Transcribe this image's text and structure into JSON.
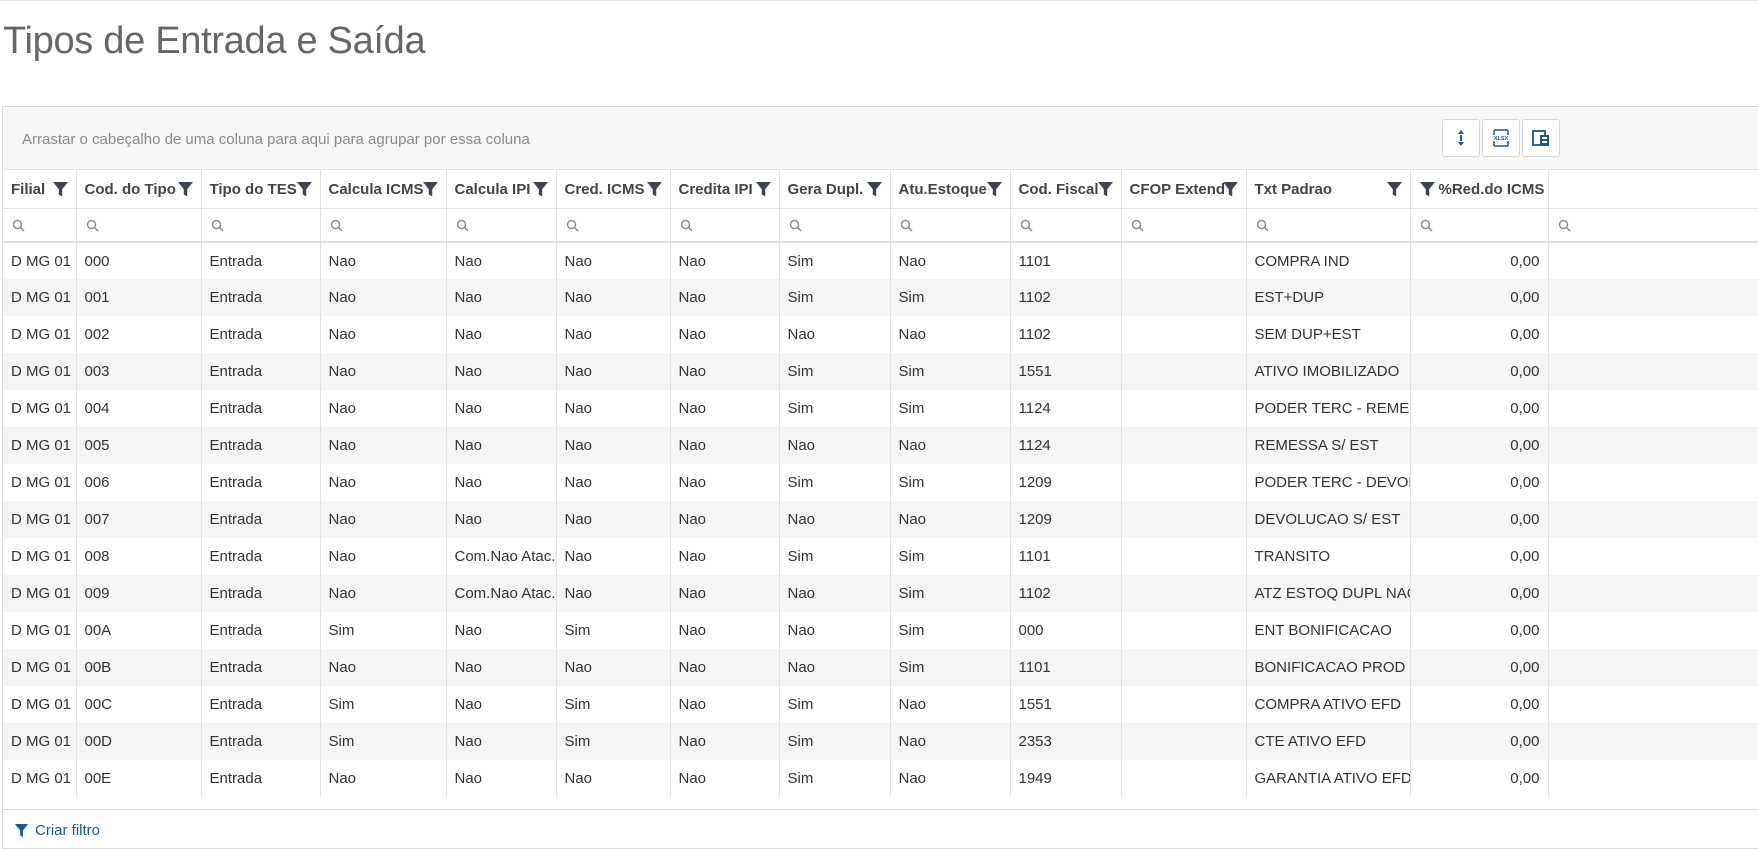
{
  "page": {
    "title": "Tipos de Entrada e Saída"
  },
  "grid": {
    "group_panel_text": "Arrastar o cabeçalho de uma coluna para aqui para agrupar por essa coluna",
    "columns": [
      {
        "label": "Filial"
      },
      {
        "label": "Cod. do Tipo"
      },
      {
        "label": "Tipo do TES"
      },
      {
        "label": "Calcula ICMS"
      },
      {
        "label": "Calcula IPI"
      },
      {
        "label": "Cred. ICMS"
      },
      {
        "label": "Credita IPI"
      },
      {
        "label": "Gera Dupl."
      },
      {
        "label": "Atu.Estoque"
      },
      {
        "label": "Cod. Fiscal"
      },
      {
        "label": "CFOP Extend"
      },
      {
        "label": "Txt Padrao"
      },
      {
        "label": "%Red.do ICMS"
      },
      {
        "label": ""
      }
    ],
    "rows": [
      [
        "D MG 01",
        "000",
        "Entrada",
        "Nao",
        "Nao",
        "Nao",
        "Nao",
        "Sim",
        "Nao",
        "1101",
        "",
        "COMPRA IND",
        "0,00"
      ],
      [
        "D MG 01",
        "001",
        "Entrada",
        "Nao",
        "Nao",
        "Nao",
        "Nao",
        "Sim",
        "Sim",
        "1102",
        "",
        "EST+DUP",
        "0,00"
      ],
      [
        "D MG 01",
        "002",
        "Entrada",
        "Nao",
        "Nao",
        "Nao",
        "Nao",
        "Nao",
        "Nao",
        "1102",
        "",
        "SEM DUP+EST",
        "0,00"
      ],
      [
        "D MG 01",
        "003",
        "Entrada",
        "Nao",
        "Nao",
        "Nao",
        "Nao",
        "Sim",
        "Sim",
        "1551",
        "",
        "ATIVO IMOBILIZADO",
        "0,00"
      ],
      [
        "D MG 01",
        "004",
        "Entrada",
        "Nao",
        "Nao",
        "Nao",
        "Nao",
        "Sim",
        "Sim",
        "1124",
        "",
        "PODER TERC - REMESSA",
        "0,00"
      ],
      [
        "D MG 01",
        "005",
        "Entrada",
        "Nao",
        "Nao",
        "Nao",
        "Nao",
        "Nao",
        "Nao",
        "1124",
        "",
        "REMESSA S/ EST",
        "0,00"
      ],
      [
        "D MG 01",
        "006",
        "Entrada",
        "Nao",
        "Nao",
        "Nao",
        "Nao",
        "Sim",
        "Sim",
        "1209",
        "",
        "PODER TERC - DEVOLUC",
        "0,00"
      ],
      [
        "D MG 01",
        "007",
        "Entrada",
        "Nao",
        "Nao",
        "Nao",
        "Nao",
        "Nao",
        "Nao",
        "1209",
        "",
        "DEVOLUCAO S/ EST",
        "0,00"
      ],
      [
        "D MG 01",
        "008",
        "Entrada",
        "Nao",
        "Com.Nao Atac.",
        "Nao",
        "Nao",
        "Sim",
        "Sim",
        "1101",
        "",
        "TRANSITO",
        "0,00"
      ],
      [
        "D MG 01",
        "009",
        "Entrada",
        "Nao",
        "Com.Nao Atac.",
        "Nao",
        "Nao",
        "Nao",
        "Sim",
        "1102",
        "",
        "ATZ ESTOQ DUPL NAO",
        "0,00"
      ],
      [
        "D MG 01",
        "00A",
        "Entrada",
        "Sim",
        "Nao",
        "Sim",
        "Nao",
        "Nao",
        "Sim",
        "000",
        "",
        "ENT BONIFICACAO",
        "0,00"
      ],
      [
        "D MG 01",
        "00B",
        "Entrada",
        "Nao",
        "Nao",
        "Nao",
        "Nao",
        "Nao",
        "Sim",
        "1101",
        "",
        "BONIFICACAO PROD",
        "0,00"
      ],
      [
        "D MG 01",
        "00C",
        "Entrada",
        "Sim",
        "Nao",
        "Sim",
        "Nao",
        "Sim",
        "Nao",
        "1551",
        "",
        "COMPRA ATIVO EFD",
        "0,00"
      ],
      [
        "D MG 01",
        "00D",
        "Entrada",
        "Sim",
        "Nao",
        "Sim",
        "Nao",
        "Sim",
        "Nao",
        "2353",
        "",
        "CTE ATIVO EFD",
        "0,00"
      ],
      [
        "D MG 01",
        "00E",
        "Entrada",
        "Nao",
        "Nao",
        "Nao",
        "Nao",
        "Sim",
        "Nao",
        "1949",
        "",
        "GARANTIA ATIVO EFD",
        "0,00"
      ]
    ],
    "toolbar": {
      "buttons": [
        {
          "icon": "sort-arrows-icon"
        },
        {
          "icon": "export-xlsx-icon"
        },
        {
          "icon": "column-chooser-icon"
        }
      ]
    },
    "footer": {
      "create_filter_label": "Criar filtro"
    }
  },
  "colors": {
    "accent": "#1a5a8e",
    "filter_icon": "#3d4450",
    "row_alt": "#f5f5f5"
  }
}
